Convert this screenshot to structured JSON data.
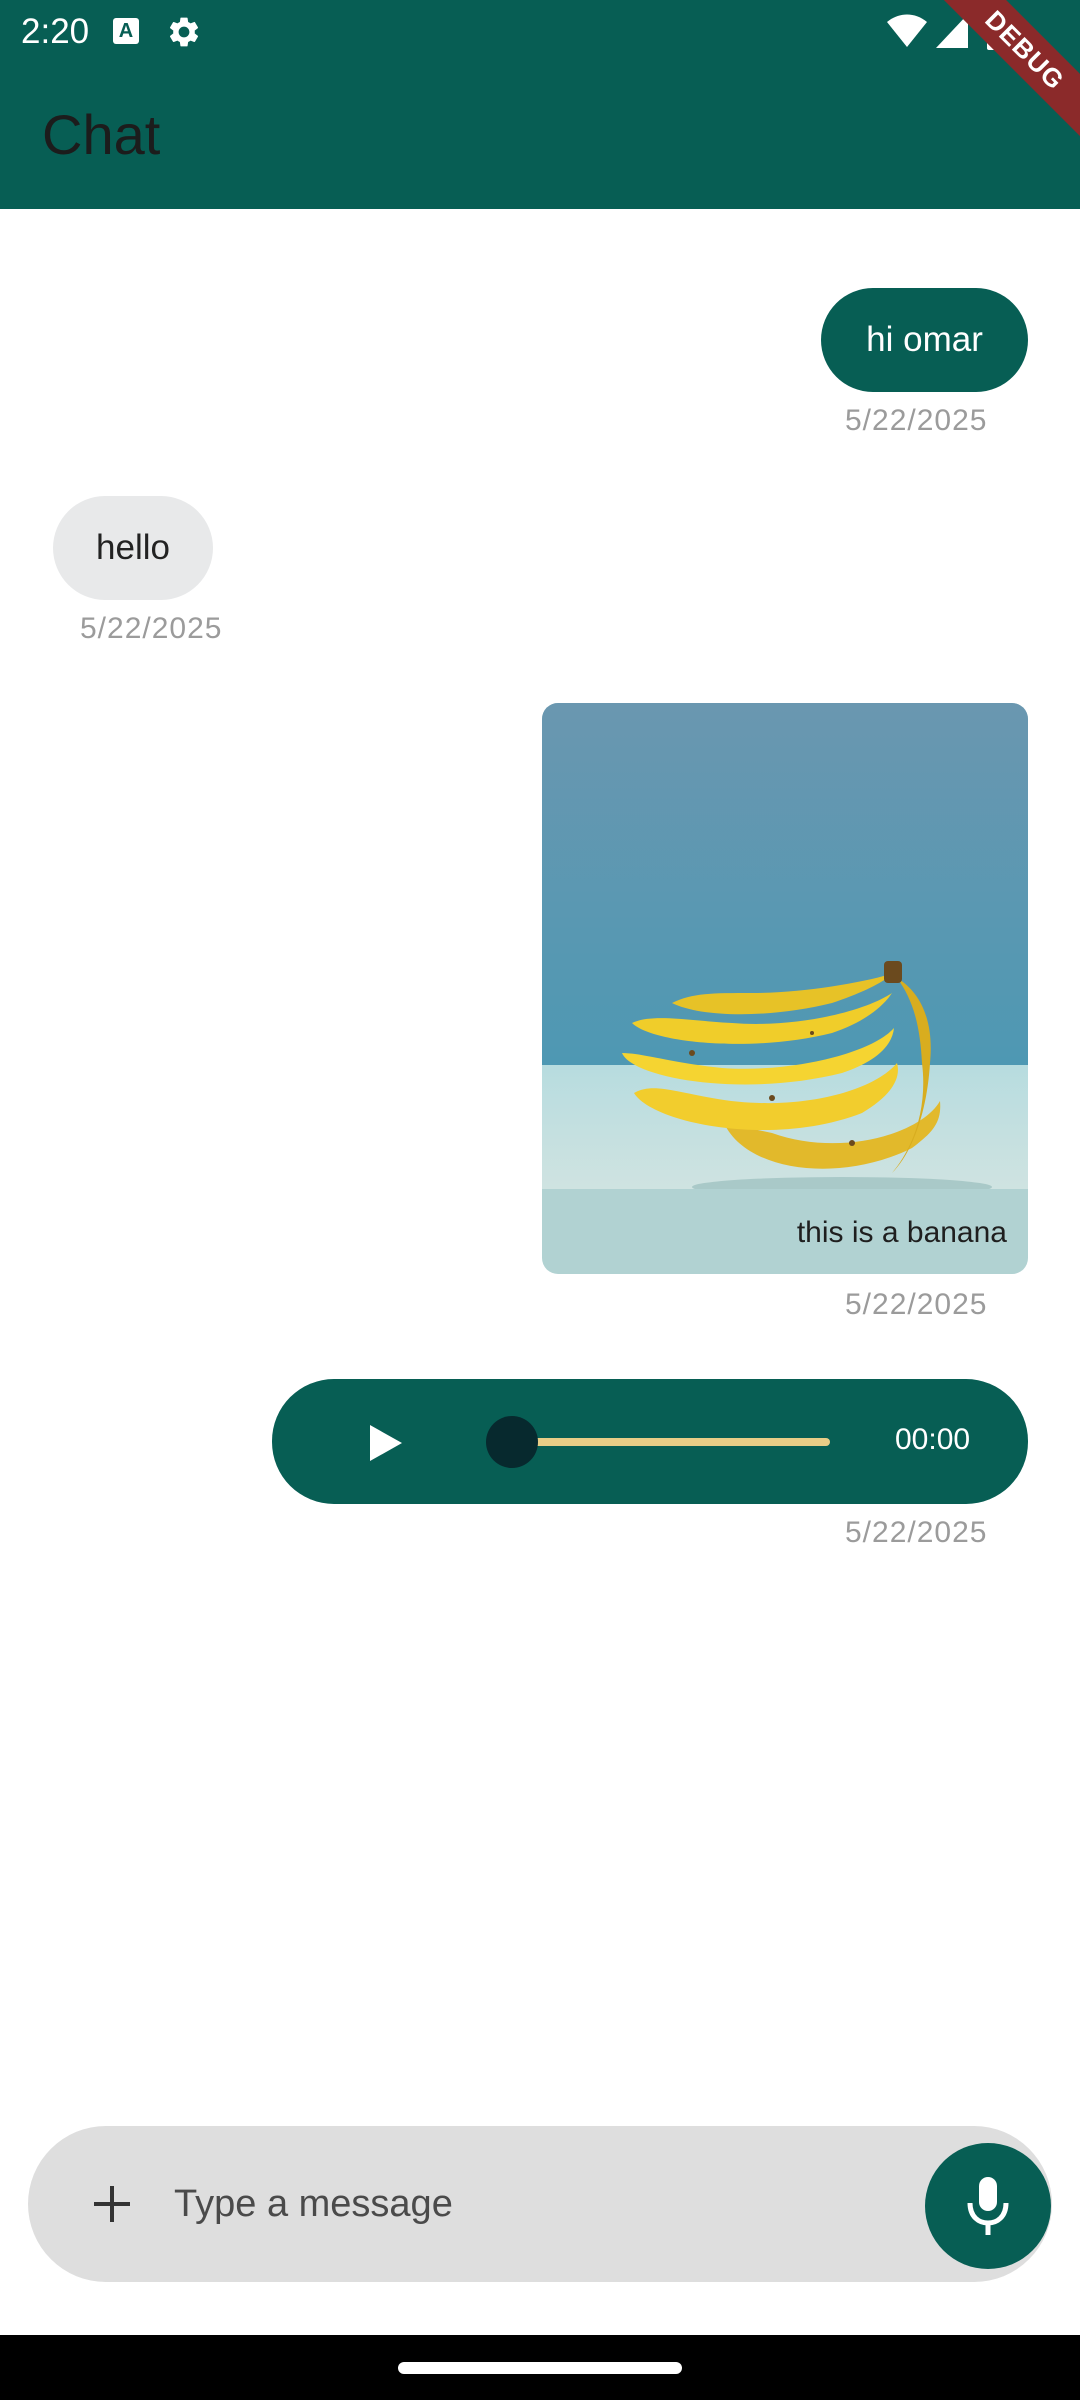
{
  "status_bar": {
    "time": "2:20",
    "icons": [
      "text-a-icon",
      "gear-icon",
      "wifi-icon",
      "signal-icon",
      "battery-icon"
    ]
  },
  "debug_banner": "DEBUG",
  "app_bar": {
    "title": "Chat"
  },
  "messages": [
    {
      "type": "text",
      "direction": "outgoing",
      "text": "hi omar",
      "date": "5/22/2025"
    },
    {
      "type": "text",
      "direction": "incoming",
      "text": "hello",
      "date": "5/22/2025"
    },
    {
      "type": "image",
      "direction": "outgoing",
      "image_description": "bunch-of-bananas",
      "caption": "this is a banana",
      "date": "5/22/2025"
    },
    {
      "type": "audio",
      "direction": "outgoing",
      "duration": "00:00",
      "progress": 0,
      "date": "5/22/2025"
    }
  ],
  "composer": {
    "placeholder": "Type a message",
    "value": "",
    "attach_icon": "plus-icon",
    "send_icon": "mic-icon"
  },
  "colors": {
    "primary": "#075E54",
    "incoming_bubble": "#e8e9ea",
    "image_bubble": "#b1d2d2",
    "seek_track": "#E8CD87",
    "timestamp": "#9b9b9b"
  }
}
